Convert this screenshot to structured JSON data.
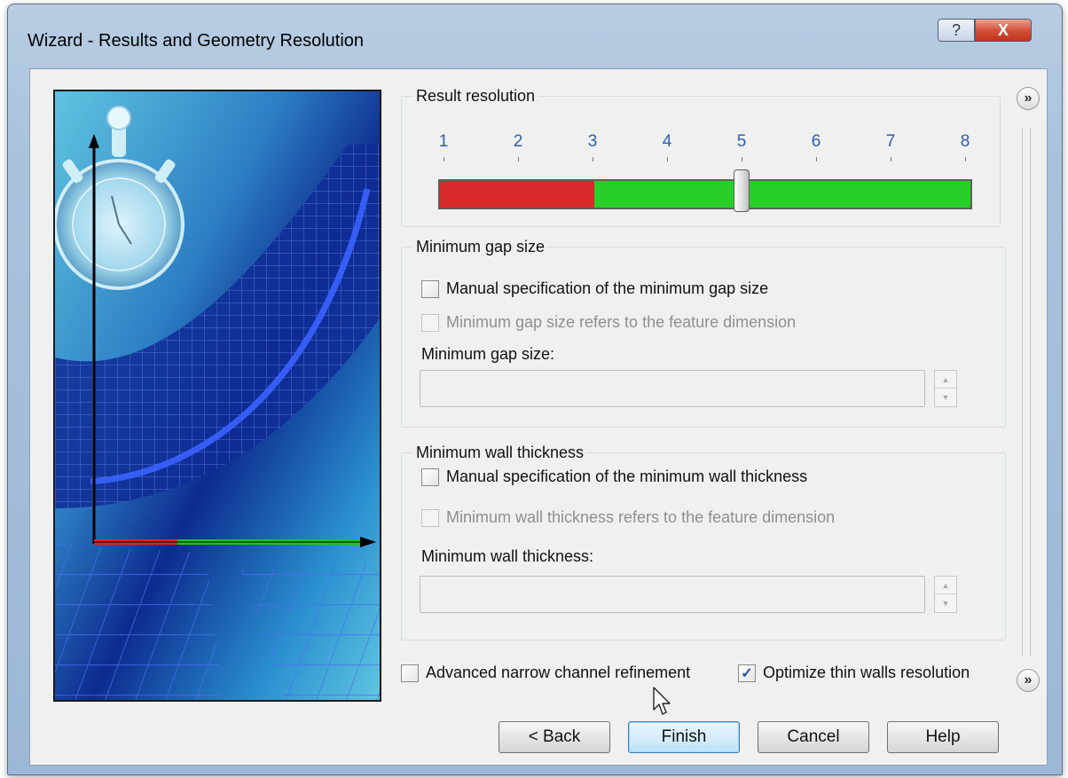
{
  "window": {
    "title": "Wizard - Results and Geometry Resolution",
    "help_glyph": "?",
    "close_glyph": "X"
  },
  "result_resolution": {
    "title": "Result resolution",
    "ticks": [
      "1",
      "2",
      "3",
      "4",
      "5",
      "6",
      "7",
      "8"
    ],
    "selected_level": 5,
    "red_until_level": 3,
    "colors": {
      "low": "#d82a2a",
      "high": "#28cf28",
      "tick_label": "#2f5fb0"
    }
  },
  "min_gap": {
    "title": "Minimum gap size",
    "manual_label": "Manual specification of the minimum gap size",
    "manual_checked": false,
    "feature_label": "Minimum gap size refers to the feature dimension",
    "feature_checked": false,
    "field_label": "Minimum gap size:",
    "field_value": ""
  },
  "min_wall": {
    "title": "Minimum wall thickness",
    "manual_label": "Manual specification of the minimum wall thickness",
    "manual_checked": false,
    "feature_label": "Minimum wall thickness refers to the feature dimension",
    "feature_checked": false,
    "field_label": "Minimum wall thickness:",
    "field_value": ""
  },
  "options": {
    "narrow_channel_label": "Advanced narrow channel refinement",
    "narrow_channel_checked": false,
    "thin_walls_label": "Optimize thin walls resolution",
    "thin_walls_checked": true
  },
  "buttons": {
    "back": "< Back",
    "finish": "Finish",
    "cancel": "Cancel",
    "help": "Help"
  },
  "side_buttons": {
    "expand_glyph": "»"
  },
  "icons": {
    "illustration": "wizard-illustration-stopwatch-mesh",
    "help": "question-icon",
    "close": "close-icon",
    "check": "checkmark-icon",
    "spin_up": "spin-up-icon",
    "spin_down": "spin-down-icon",
    "cursor": "mouse-pointer-icon"
  }
}
